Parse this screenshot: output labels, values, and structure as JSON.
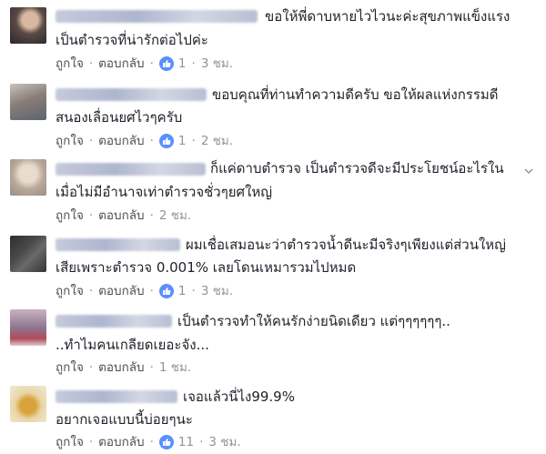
{
  "ui": {
    "like_label": "ถูกใจ",
    "reply_label": "ตอบกลับ",
    "dot": "·",
    "colors": {
      "text": "#1d2129",
      "meta": "#90949c",
      "link": "#4b4f56",
      "like_blue": "#5890ff"
    }
  },
  "comments": [
    {
      "lines": [
        "ขอให้พี่ดาบหายไวไวนะค่ะสุขภาพแข็งแรง",
        "เป็นตำรวจที่น่ารักต่อไปค่ะ"
      ],
      "likes": "1",
      "time": "3 ชม."
    },
    {
      "lines": [
        "ขอบคุณที่ท่านทำความดีครับ ขอให้ผลแห่งกรรมดี",
        "สนองเลื่อนยศไวๆครับ"
      ],
      "likes": "1",
      "time": "2 ชม."
    },
    {
      "lines": [
        "ก็แค่ดาบตำรวจ เป็นตำรวจดีจะมีประโยชน์อะไรใน",
        "เมื่อไม่มีอำนาจเท่าตำรวจชั่วๆยศใหญ่"
      ],
      "likes": "",
      "time": "2 ชม."
    },
    {
      "lines": [
        "ผมเชื่อเสมอนะว่าตำรวจน้ำดีนะมีจริงๆเพียงแต่ส่วนใหญ่",
        "เสียเพราะตำรวจ 0.001% เลยโดนเหมารวมไปหมด"
      ],
      "likes": "1",
      "time": "3 ชม."
    },
    {
      "lines": [
        "เป็นตำรวจทำให้คนรักง่ายนิดเดียว แต่ๆๆๆๆๆๆ..",
        "..ทำไมคนเกลียดเยอะจัง..."
      ],
      "likes": "",
      "time": "1 ชม."
    },
    {
      "lines": [
        "เจอแล้วนี่ไง99.9%",
        "อยากเจอแบบนี้บ่อยๆนะ"
      ],
      "likes": "11",
      "time": "3 ชม."
    }
  ]
}
